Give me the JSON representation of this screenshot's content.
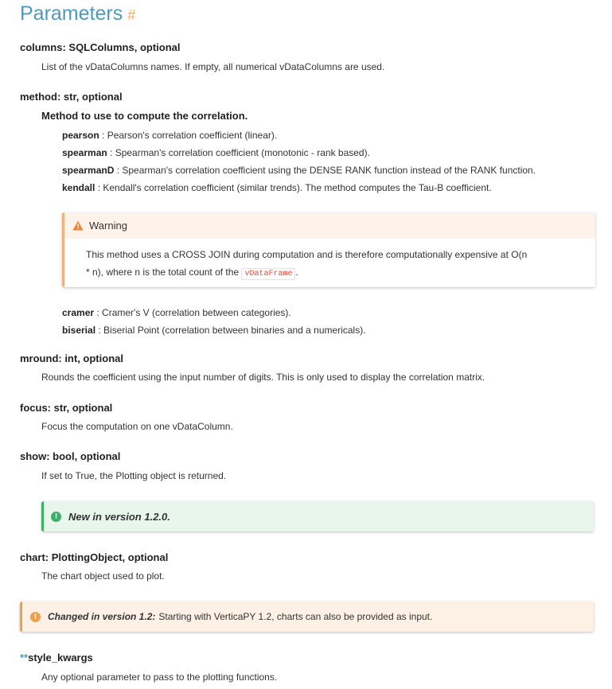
{
  "heading": {
    "title": "Parameters",
    "anchor": "#"
  },
  "columns": {
    "term": "columns: SQLColumns, optional",
    "desc": "List of the vDataColumns names. If empty, all numerical vDataColumns are used."
  },
  "method": {
    "term": "method: str, optional",
    "subheading": "Method to use to compute the correlation.",
    "items": [
      {
        "name": "pearson",
        "desc": " : Pearson's correlation coefficient (linear)."
      },
      {
        "name": "spearman",
        "desc": " : Spearman's correlation coefficient (monotonic - rank based)."
      },
      {
        "name": "spearmanD",
        "desc": " : Spearman's correlation coefficient using the DENSE RANK function instead of the RANK function."
      },
      {
        "name": "kendall",
        "desc": " : Kendall's correlation coefficient (similar trends). The method computes the Tau-B coefficient."
      }
    ],
    "warning": {
      "title": "Warning",
      "line1": "This method uses a CROSS JOIN during computation and is therefore computationally expensive at O(n",
      "line2_pre": "* n), where n is the total count of the ",
      "code": "vDataFrame",
      "line2_post": "."
    },
    "items2": [
      {
        "name": "cramer",
        "desc": " : Cramer's V (correlation between categories)."
      },
      {
        "name": "biserial",
        "desc": " : Biserial Point (correlation between binaries and a numericals)."
      }
    ]
  },
  "mround": {
    "term": "mround: int, optional",
    "desc": "Rounds the coefficient using the input number of digits. This is only used to display the correlation matrix."
  },
  "focus": {
    "term": "focus: str, optional",
    "desc": "Focus the computation on one vDataColumn."
  },
  "show": {
    "term": "show: bool, optional",
    "desc": "If set to True, the Plotting object is returned.",
    "note": "New in version 1.2.0."
  },
  "chart": {
    "term": "chart: PlottingObject, optional",
    "desc": "The chart object used to plot."
  },
  "changed": {
    "label": "Changed in version 1.2:",
    "text": "Starting with VerticaPY 1.2, charts can also be provided as input."
  },
  "style_kwargs": {
    "stars": "**",
    "term": "style_kwargs",
    "desc": "Any optional parameter to pass to the plotting functions."
  },
  "colors": {
    "heading": "#4a9bbd",
    "anchor": "#f0b071",
    "warning_accent": "#f0b37e",
    "note_green": "#3bb067",
    "changed_accent": "#f0a04b",
    "code": "#e74c3c"
  },
  "icons": {
    "warning": "warning-triangle-icon",
    "new": "exclamation-circle-icon",
    "changed": "exclamation-circle-icon"
  }
}
